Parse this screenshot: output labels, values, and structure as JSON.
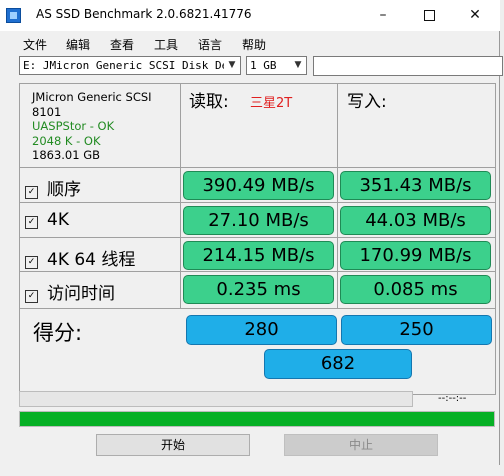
{
  "window": {
    "title": "AS SSD Benchmark 2.0.6821.41776",
    "min": "–",
    "close": "✕"
  },
  "menu": [
    "文件",
    "编辑",
    "查看",
    "工具",
    "语言",
    "帮助"
  ],
  "toolbar": {
    "drive": "E: JMicron Generic SCSI Disk Devi",
    "size": "1 GB",
    "search_value": ""
  },
  "drive_info": {
    "name": "JMicron Generic SCSI",
    "fw": "8101",
    "driver": "UASPStor - OK",
    "align": "2048 K - OK",
    "capacity": "1863.01 GB"
  },
  "columns": {
    "read": "读取:",
    "read_note": "三星2T",
    "write": "写入:"
  },
  "rows": [
    {
      "label": "顺序",
      "read": "390.49 MB/s",
      "write": "351.43 MB/s",
      "checked": true
    },
    {
      "label": "4K",
      "read": "27.10 MB/s",
      "write": "44.03 MB/s",
      "checked": true
    },
    {
      "label": "4K 64 线程",
      "read": "214.15 MB/s",
      "write": "170.99 MB/s",
      "checked": true
    },
    {
      "label": "访问时间",
      "read": "0.235 ms",
      "write": "0.085 ms",
      "checked": true
    }
  ],
  "score": {
    "label": "得分:",
    "read": "280",
    "write": "250",
    "total": "682"
  },
  "status": {
    "time": "--:--:--",
    "progress_percent": 100
  },
  "buttons": {
    "start": "开始",
    "stop": "中止"
  },
  "colors": {
    "result_green": "#3cd08c",
    "score_blue": "#1faee8",
    "progress_green": "#06b025",
    "note_red": "#e02020"
  }
}
